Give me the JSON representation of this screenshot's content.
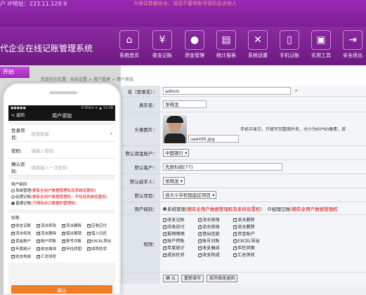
{
  "topbar": {
    "ip": "户 IP地址：223.11.129.9",
    "notice": "为保证数据安全，请您不要将账号密码告诉他人"
  },
  "header": {
    "system_name": "代企业在线记账管理系统",
    "nav": [
      {
        "label": "系统首页",
        "icon": "home-icon",
        "glyph": "⌂"
      },
      {
        "label": "收支记账",
        "icon": "ledger-icon",
        "glyph": "¥"
      },
      {
        "label": "资金管理",
        "icon": "piggy-bank-icon",
        "glyph": "●"
      },
      {
        "label": "统计报表",
        "icon": "chart-icon",
        "glyph": "▤"
      },
      {
        "label": "系统设置",
        "icon": "tools-icon",
        "glyph": "✕"
      },
      {
        "label": "手机记账",
        "icon": "phone-icon",
        "glyph": "▯"
      },
      {
        "label": "实用工具",
        "icon": "toolbox-icon",
        "glyph": "▣"
      },
      {
        "label": "安全退出",
        "icon": "exit-icon",
        "glyph": "⇥"
      }
    ]
  },
  "sidebar": {
    "start_label": "开始"
  },
  "breadcrumb": "您现在的位置：系统设置 > 用户管理 > 用户添加",
  "phone": {
    "status_left": "●●●●●",
    "status_right": "0.00k/s ≋ ▲ 13:38",
    "back_label": "< 返回",
    "title": "用户添加",
    "fields": [
      {
        "label": "登录项目:",
        "value": "金晓智能"
      },
      {
        "label": "密码:",
        "value": "请输入密码"
      },
      {
        "label": "确认密码:",
        "value": "请再输入一次密码"
      }
    ],
    "level_title": "用户级别:",
    "levels": [
      {
        "label": "系统管理",
        "note": "(拥有全用户数据管理权及系统设置权)",
        "on": false
      },
      {
        "label": "经理记账",
        "note": "(拥有全用户数据管理权，不包括系统设置权)",
        "on": false
      },
      {
        "label": "普通记账",
        "note": "(只拥有自己数据的管理权)",
        "on": true
      }
    ],
    "perm_title": "权限:",
    "perms": [
      "收支记账",
      "流水修改",
      "流水删除",
      "应收应付",
      "流水修改",
      "流水删除",
      "借出报销",
      "借入归还",
      "资金账户",
      "账户转账",
      "账号对账",
      "EXCEL导出",
      "年度统计",
      "收支曲线",
      "年柱状图",
      "成员柱状",
      "收支构成",
      "汇总饼状"
    ],
    "submit_label": "确认"
  },
  "form": {
    "login_label": "名（登录名）：",
    "login_value": "admin",
    "required_mark": "*",
    "realname_label": "真实名：",
    "realname_value": "张晓龙",
    "avatar_label": "头像图片：",
    "avatar_file": "user00.jpg",
    "avatar_hint": "手机中显示，只填写完整图片名，大小为60*60像素，放",
    "account_label": "默认资金账户：",
    "account_value": "中国银行 ▾",
    "client_label": "默认客户：",
    "client_value": "先辰科技[77]",
    "handler_label": "默认经手人：",
    "handler_value": "张晓龙 ▾",
    "project_label": "默认项目：",
    "project_value": "佳大小学校园监控项目 ▾",
    "level_label": "用户级别：",
    "level_options": [
      {
        "label": "系统管理",
        "note": "(拥有全用户数据管理权及系统设置权)",
        "on": true
      },
      {
        "label": "经理记账",
        "note": "(拥有全用户数据管理权",
        "on": false
      }
    ],
    "perm_label": "权限：",
    "perms": [
      "收支记账",
      "流水修改",
      "流水删除",
      "应收应付",
      "流水修改",
      "流水删除",
      "报销销销",
      "借出还款",
      "资金账户",
      "账户转账",
      "账号对账",
      "EXCEL导出",
      "年度统计",
      "收支曲线",
      "年柱状图",
      "成员柱状",
      "收支构成",
      "汇总饼状"
    ],
    "btn_ok": "确 认",
    "btn_reset": "重新填写",
    "btn_back": "放弃修改返回"
  }
}
